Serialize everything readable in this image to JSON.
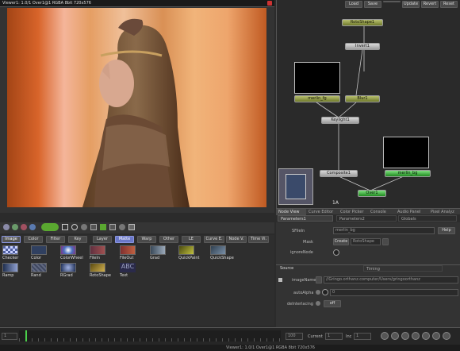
{
  "viewer": {
    "title": "Viewer1: 1.0/1 Over1@1 RGBA 8bit 720x576",
    "status": "Viewer1: 1.0/1 Over1@1 RGBA 8bit 720x576"
  },
  "flow": {
    "toolbar": [
      "Load",
      "Save",
      "",
      "Update",
      "Revert",
      "Reset"
    ],
    "nodes": {
      "rotoshape": "RotoShape1",
      "invert": "Invert1",
      "merlin_fg": "merlin_fg",
      "blur": "Blur1",
      "keylight": "Keylight1",
      "composite": "Composite1",
      "merlin_bg": "merlin_bg",
      "over": "Over1"
    },
    "nav_label": "1A"
  },
  "tool_tabs": [
    "Image",
    "Color",
    "Filter",
    "Key",
    "Layer",
    "Matte",
    "Warp",
    "Other",
    "LE",
    "Curve E.",
    "Node V.",
    "Time Vi."
  ],
  "tools": [
    {
      "name": "Checker",
      "color": "#8898c8"
    },
    {
      "name": "Color",
      "color": "#304060"
    },
    {
      "name": "ColorWheel",
      "color": "#4060a0"
    },
    {
      "name": "FileIn",
      "color": "#603040"
    },
    {
      "name": "FileOut",
      "color": "#703030"
    },
    {
      "name": "Grad",
      "color": "#607080"
    },
    {
      "name": "QuickPaint",
      "color": "#6a6a20"
    },
    {
      "name": "QuickShape",
      "color": "#405060"
    },
    {
      "name": "Ramp",
      "color": "#506080"
    },
    {
      "name": "Rand",
      "color": "#404860"
    },
    {
      "name": "RGrad",
      "color": "#3a4a70"
    },
    {
      "name": "RotoShape",
      "color": "#807030"
    },
    {
      "name": "Text",
      "color": "#2a2a4a"
    }
  ],
  "text_icon_label": "ABC",
  "bottom_tabs": [
    "Node View",
    "Curve Editor",
    "Color Picker",
    "Console",
    "Audio Panel",
    "Pixel Analyz"
  ],
  "params": {
    "tabs": [
      "Parameters1",
      "Parameters2",
      "Globals"
    ],
    "help": "Help",
    "sfile_label": "SFileIn",
    "sfile_value": "merlin_bg",
    "mask_label": "Mask",
    "mask_create": "Create",
    "mask_value": "RotoShape",
    "ignore_node": "ignoreNode",
    "sub_tabs": [
      "Source",
      "Timing"
    ],
    "image_name_label": "imageName",
    "image_name_value": "//Gringo.orthanz.computer/Users/gringoorthanz",
    "auto_alpha_label": "autoAlpha",
    "auto_alpha_value": "0",
    "deinterlacing_label": "deInterlacing",
    "deinterlacing_value": "off"
  },
  "timeline": {
    "start": "1",
    "end": "100",
    "current_label": "Current",
    "current_value": "1",
    "inc_label": "Inc",
    "inc_value": "1"
  }
}
